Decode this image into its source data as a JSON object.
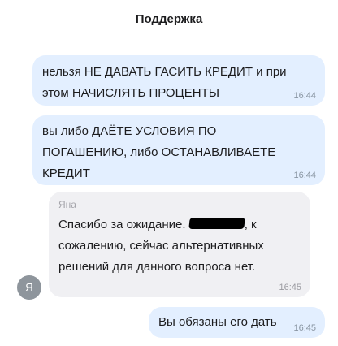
{
  "header": {
    "title": "Поддержка"
  },
  "messages": [
    {
      "direction": "outgoing",
      "lines": [
        "нельзя НЕ ДАВАТЬ ГАСИТЬ КРЕДИТ и при",
        "этом НАЧИСЛЯТЬ ПРОЦЕНТЫ"
      ],
      "time": "16:44"
    },
    {
      "direction": "outgoing",
      "lines": [
        "вы либо ДАЁТЕ УСЛОВИЯ ПО",
        "ПОГАШЕНИЮ, либо ОСТАНАВЛИВАЕТЕ",
        "КРЕДИТ"
      ],
      "time": "16:44"
    },
    {
      "direction": "incoming",
      "sender": "Яна",
      "line1_before": "Спасибо за ожидание. ",
      "line1_after": ", к",
      "lines": [
        "сожалению, сейчас альтернативных",
        "решений для данного вопроса нет."
      ],
      "time": "16:45",
      "avatar_letter": "Я"
    },
    {
      "direction": "outgoing",
      "lines": [
        "Вы обязаны его дать"
      ],
      "time": "16:45"
    }
  ],
  "colors": {
    "outgoing_bubble": "#e3efff",
    "incoming_bubble": "#f0f0f3",
    "avatar_bg": "#8e959c"
  }
}
